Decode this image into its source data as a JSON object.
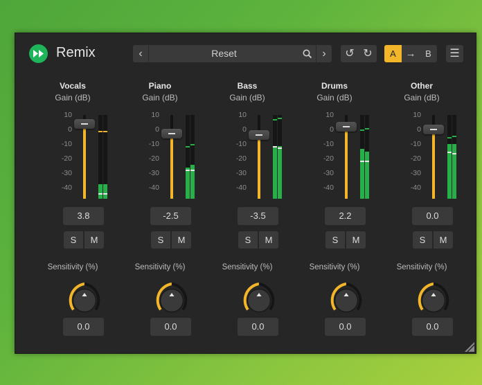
{
  "app": {
    "title": "Remix"
  },
  "toolbar": {
    "preset_name": "Reset",
    "prev_icon": "chevron-left-icon",
    "next_icon": "chevron-right-icon",
    "search_icon": "search-icon",
    "undo_icon": "undo-icon",
    "redo_icon": "redo-icon",
    "ab_a_label": "A",
    "ab_b_label": "B",
    "ab_copy_icon": "arrow-right-icon",
    "menu_icon": "hamburger-menu-icon"
  },
  "colors": {
    "accent": "#f3b62a",
    "meter": "#27b04a",
    "panel": "#262626",
    "logo": "#1fb35a"
  },
  "scale_ticks": [
    "10",
    "0",
    "-10",
    "-20",
    "-30",
    "-40"
  ],
  "channels": [
    {
      "name": "Vocals",
      "gain_label": "Gain (dB)",
      "gain_value": "3.8",
      "solo_label": "S",
      "mute_label": "M",
      "sensitivity_label": "Sensitivity (%)",
      "sensitivity_value": "0.0",
      "meter_levels_db": [
        -37,
        -37
      ],
      "meter_peaks_db": [
        -43,
        -43
      ],
      "meter_holds_db": [
        -1,
        -1
      ]
    },
    {
      "name": "Piano",
      "gain_label": "Gain (dB)",
      "gain_value": "-2.5",
      "solo_label": "S",
      "mute_label": "M",
      "sensitivity_label": "Sensitivity (%)",
      "sensitivity_value": "0.0",
      "meter_levels_db": [
        -26,
        -24
      ],
      "meter_peaks_db": [
        -27,
        -27
      ],
      "meter_holds_db": [
        -11,
        -10
      ]
    },
    {
      "name": "Bass",
      "gain_label": "Gain (dB)",
      "gain_value": "-3.5",
      "solo_label": "S",
      "mute_label": "M",
      "sensitivity_label": "Sensitivity (%)",
      "sensitivity_value": "0.0",
      "meter_levels_db": [
        -11,
        -11
      ],
      "meter_peaks_db": [
        -11,
        -12
      ],
      "meter_holds_db": [
        7,
        8
      ]
    },
    {
      "name": "Drums",
      "gain_label": "Gain (dB)",
      "gain_value": "2.2",
      "solo_label": "S",
      "mute_label": "M",
      "sensitivity_label": "Sensitivity (%)",
      "sensitivity_value": "0.0",
      "meter_levels_db": [
        -13,
        -15
      ],
      "meter_peaks_db": [
        -21,
        -21
      ],
      "meter_holds_db": [
        0,
        1
      ]
    },
    {
      "name": "Other",
      "gain_label": "Gain (dB)",
      "gain_value": "0.0",
      "solo_label": "S",
      "mute_label": "M",
      "sensitivity_label": "Sensitivity (%)",
      "sensitivity_value": "0.0",
      "meter_levels_db": [
        -10,
        -10
      ],
      "meter_peaks_db": [
        -15,
        -16
      ],
      "meter_holds_db": [
        -5,
        -4
      ]
    }
  ]
}
